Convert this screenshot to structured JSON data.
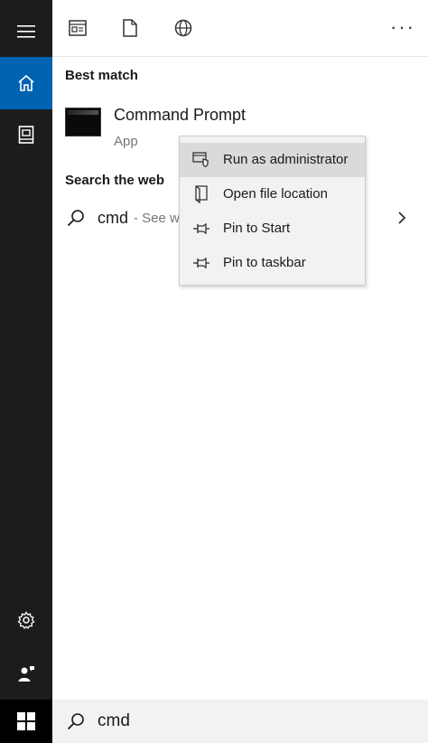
{
  "window": {
    "more_label": "···"
  },
  "topbar": {
    "filters": [
      {
        "icon": "apps-filter-icon"
      },
      {
        "icon": "documents-filter-icon"
      },
      {
        "icon": "web-filter-icon"
      }
    ]
  },
  "rail": {
    "items": [
      {
        "icon": "hamburger-menu-icon"
      },
      {
        "icon": "home-icon",
        "active": true
      },
      {
        "icon": "notebook-icon"
      },
      {
        "icon": "settings-gear-icon"
      },
      {
        "icon": "feedback-person-icon"
      }
    ]
  },
  "best_match": {
    "heading": "Best match",
    "title": "Command Prompt",
    "subtitle": "App"
  },
  "web": {
    "heading": "Search the web",
    "query": "cmd",
    "hint": "- See w"
  },
  "context_menu": {
    "items": [
      {
        "label": "Run as administrator",
        "icon": "admin-shield-icon",
        "hover": true
      },
      {
        "label": "Open file location",
        "icon": "file-location-icon"
      },
      {
        "label": "Pin to Start",
        "icon": "pin-icon"
      },
      {
        "label": "Pin to taskbar",
        "icon": "pin-icon"
      }
    ]
  },
  "searchbar": {
    "value": "cmd"
  },
  "colors": {
    "rail_bg": "#1c1c1c",
    "accent": "#0063b1",
    "menu_bg": "#f2f2f2",
    "menu_hover": "#dadada"
  }
}
